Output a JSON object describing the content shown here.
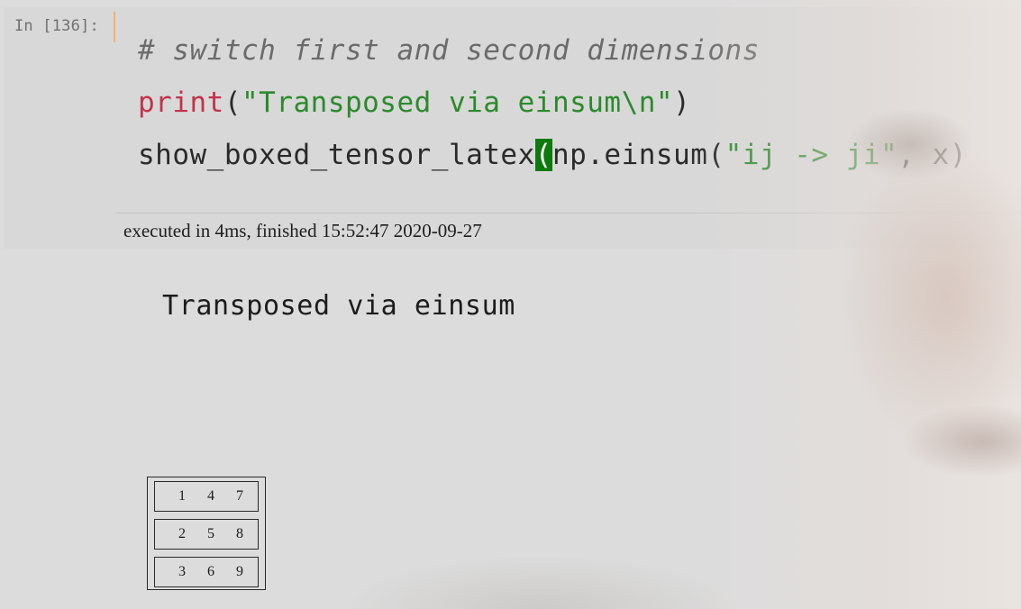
{
  "cell": {
    "prompt": "In [136]:",
    "code": {
      "line1_comment": "# switch first and second dimensions",
      "line2_fn": "print",
      "line2_open": "(",
      "line2_str": "\"Transposed via einsum\\n\"",
      "line2_close": ")",
      "line3_fn": "show_boxed_tensor_latex",
      "line3_paren": "(",
      "line3_call": "np.einsum(",
      "line3_str": "\"ij -> ji\"",
      "line3_rest": ", x)"
    },
    "execution_info": "executed in 4ms, finished 15:52:47 2020-09-27"
  },
  "output": {
    "text": "Transposed via einsum",
    "tensor": [
      [
        "1",
        "4",
        "7"
      ],
      [
        "2",
        "5",
        "8"
      ],
      [
        "3",
        "6",
        "9"
      ]
    ]
  },
  "colors": {
    "keyword": "#c4324a",
    "string": "#2b8a2b",
    "cursor_highlight": "#0e7a0e",
    "focus_bar": "#f0b46c"
  }
}
